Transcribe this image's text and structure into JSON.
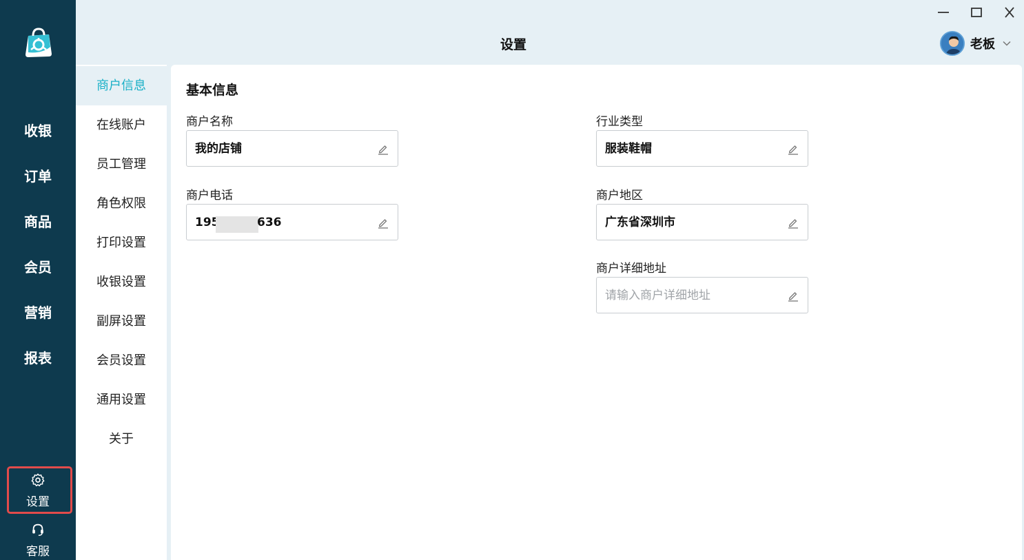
{
  "colors": {
    "nav_bg": "#0e3a4e",
    "accent": "#1ab0c7",
    "app_bg": "#e6f0f5",
    "highlight_border": "#e24b4b"
  },
  "nav": {
    "logo_icon": "shopping-bag-logo-icon",
    "items": [
      "收银",
      "订单",
      "商品",
      "会员",
      "营销",
      "报表"
    ],
    "settings": {
      "label": "设置",
      "icon": "gear-icon"
    },
    "support": {
      "label": "客服",
      "icon": "headset-icon"
    }
  },
  "header": {
    "title": "设置",
    "user": {
      "name": "老板",
      "avatar_icon": "user-avatar",
      "caret_icon": "chevron-down-icon"
    },
    "window_controls": [
      "minimize-icon",
      "maximize-icon",
      "close-icon"
    ]
  },
  "submenu": {
    "active": "商户信息",
    "items": [
      "商户信息",
      "在线账户",
      "员工管理",
      "角色权限",
      "打印设置",
      "收银设置",
      "副屏设置",
      "会员设置",
      "通用设置",
      "关于"
    ]
  },
  "main": {
    "section_title": "基本信息",
    "fields": {
      "merchant_name": {
        "label": "商户名称",
        "value": "我的店铺"
      },
      "industry": {
        "label": "行业类型",
        "value": "服装鞋帽"
      },
      "phone": {
        "label": "商户电话",
        "value_prefix": "195",
        "value_suffix": "636"
      },
      "region": {
        "label": "商户地区",
        "value": "广东省深圳市"
      },
      "address": {
        "label": "商户详细地址",
        "value": "",
        "placeholder": "请输入商户详细地址"
      }
    },
    "edit_icon": "pencil-edit-icon"
  }
}
